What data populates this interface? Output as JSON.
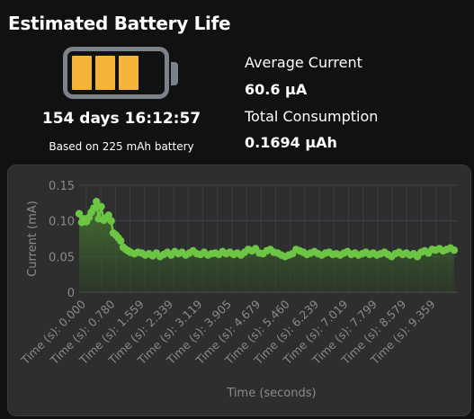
{
  "title": "Estimated Battery Life",
  "battery": {
    "fill_fraction": 0.75,
    "fill_color": "#f7b43c",
    "frame_color": "#7b8289"
  },
  "duration": "154 days 16:12:57",
  "capacity_note": "Based on 225 mAh battery",
  "stats": {
    "avg_label": "Average Current",
    "avg_value": "60.6 µA",
    "total_label": "Total Consumption",
    "total_value": "0.1694 µAh"
  },
  "chart_data": {
    "type": "area",
    "ylabel": "Current (mA)",
    "xlabel": "Time (seconds)",
    "ylim": [
      0,
      0.15
    ],
    "yticks": [
      "0",
      "0.05",
      "0.10",
      "0.15"
    ],
    "xticks": [
      "Time (s): 0.000",
      "Time (s): 0.780",
      "Time (s): 1.559",
      "Time (s): 2.339",
      "Time (s): 3.119",
      "Time (s): 3.905",
      "Time (s): 4.679",
      "Time (s): 5.460",
      "Time (s): 6.239",
      "Time (s): 7.019",
      "Time (s): 7.799",
      "Time (s): 8.579",
      "Time (s): 9.359"
    ],
    "xlim": [
      0,
      10.3
    ],
    "grid": true,
    "line_color": "#6cc644",
    "series": [
      {
        "x": [
          0.0,
          0.07,
          0.13,
          0.2,
          0.27,
          0.33,
          0.4,
          0.47,
          0.53,
          0.6,
          0.67,
          0.73,
          0.8,
          0.87,
          0.93,
          1.0,
          1.07,
          1.13,
          1.2,
          1.27,
          1.33,
          1.4,
          1.5,
          1.6,
          1.7,
          1.8,
          1.9,
          2.0,
          2.1,
          2.2,
          2.3,
          2.4,
          2.5,
          2.6,
          2.7,
          2.8,
          2.9,
          3.0,
          3.1,
          3.2,
          3.3,
          3.4,
          3.5,
          3.6,
          3.7,
          3.8,
          3.9,
          4.0,
          4.1,
          4.2,
          4.3,
          4.4,
          4.5,
          4.6,
          4.7,
          4.8,
          4.9,
          5.0,
          5.1,
          5.2,
          5.3,
          5.4,
          5.5,
          5.6,
          5.7,
          5.8,
          5.9,
          6.0,
          6.1,
          6.2,
          6.3,
          6.4,
          6.5,
          6.6,
          6.7,
          6.8,
          6.9,
          7.0,
          7.1,
          7.2,
          7.3,
          7.4,
          7.5,
          7.6,
          7.7,
          7.8,
          7.9,
          8.0,
          8.1,
          8.2,
          8.3,
          8.4,
          8.5,
          8.6,
          8.7,
          8.8,
          8.9,
          9.0,
          9.1,
          9.2,
          9.3,
          9.4,
          9.5,
          9.6,
          9.7,
          9.8,
          9.9,
          10.0,
          10.1,
          10.2
        ],
        "y": [
          0.11,
          0.098,
          0.103,
          0.099,
          0.105,
          0.112,
          0.118,
          0.127,
          0.103,
          0.12,
          0.101,
          0.104,
          0.108,
          0.1,
          0.083,
          0.08,
          0.076,
          0.072,
          0.063,
          0.06,
          0.058,
          0.056,
          0.054,
          0.056,
          0.055,
          0.052,
          0.054,
          0.051,
          0.055,
          0.05,
          0.053,
          0.056,
          0.052,
          0.057,
          0.054,
          0.056,
          0.052,
          0.055,
          0.058,
          0.054,
          0.053,
          0.056,
          0.052,
          0.054,
          0.055,
          0.053,
          0.057,
          0.054,
          0.056,
          0.053,
          0.055,
          0.052,
          0.056,
          0.06,
          0.058,
          0.061,
          0.055,
          0.054,
          0.058,
          0.06,
          0.056,
          0.055,
          0.052,
          0.05,
          0.052,
          0.054,
          0.06,
          0.058,
          0.056,
          0.053,
          0.055,
          0.057,
          0.054,
          0.052,
          0.055,
          0.056,
          0.053,
          0.054,
          0.052,
          0.055,
          0.057,
          0.053,
          0.055,
          0.052,
          0.054,
          0.056,
          0.053,
          0.055,
          0.052,
          0.054,
          0.056,
          0.053,
          0.05,
          0.054,
          0.056,
          0.053,
          0.055,
          0.052,
          0.054,
          0.05,
          0.056,
          0.058,
          0.055,
          0.06,
          0.059,
          0.061,
          0.058,
          0.06,
          0.062,
          0.059
        ]
      }
    ]
  }
}
